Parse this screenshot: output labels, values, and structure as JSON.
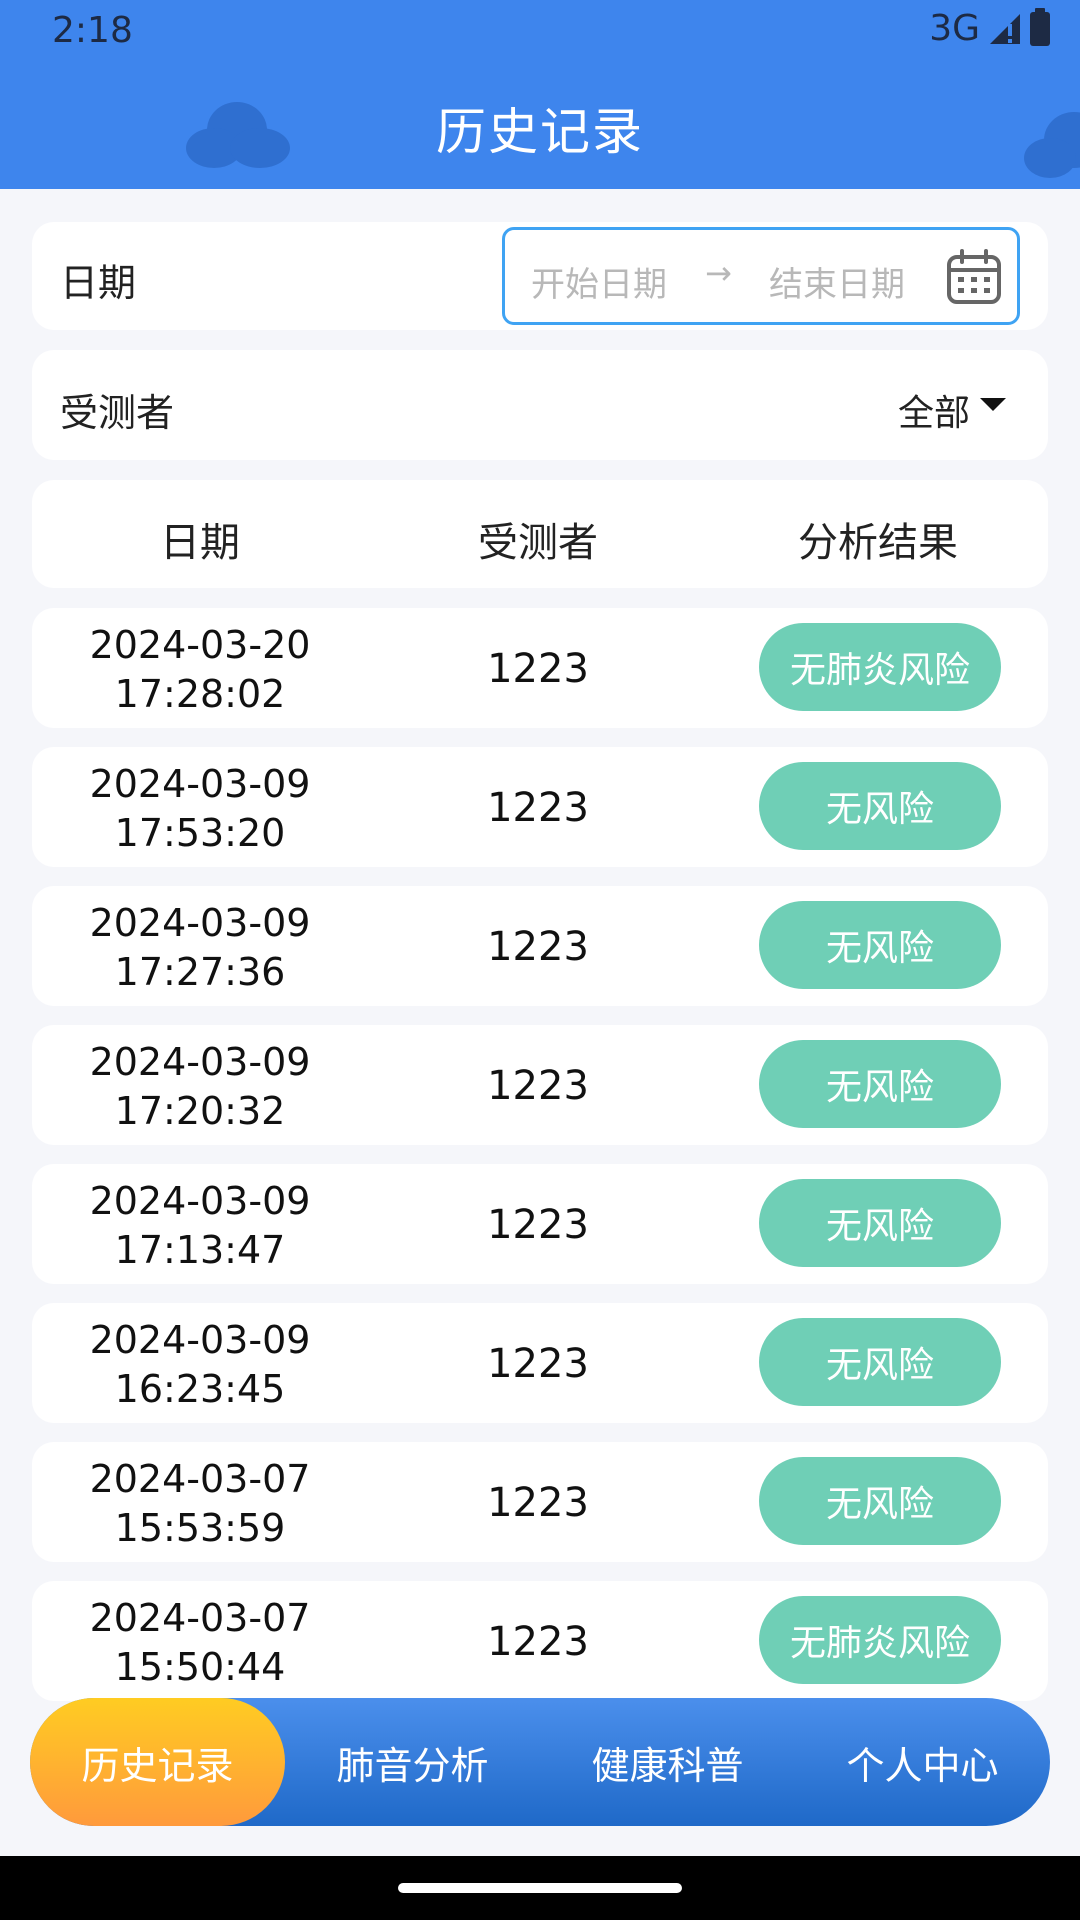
{
  "status_bar": {
    "time": "2:18",
    "network": "3G"
  },
  "header": {
    "title": "历史记录"
  },
  "filter": {
    "date_label": "日期",
    "start_placeholder": "开始日期",
    "range_arrow": "→",
    "end_placeholder": "结束日期",
    "subject_label": "受测者",
    "subject_value": "全部"
  },
  "table": {
    "columns": [
      "日期",
      "受测者",
      "分析结果"
    ],
    "rows": [
      {
        "date": "2024-03-20",
        "time": "17:28:02",
        "subject": "1223",
        "result": "无肺炎风险"
      },
      {
        "date": "2024-03-09",
        "time": "17:53:20",
        "subject": "1223",
        "result": "无风险"
      },
      {
        "date": "2024-03-09",
        "time": "17:27:36",
        "subject": "1223",
        "result": "无风险"
      },
      {
        "date": "2024-03-09",
        "time": "17:20:32",
        "subject": "1223",
        "result": "无风险"
      },
      {
        "date": "2024-03-09",
        "time": "17:13:47",
        "subject": "1223",
        "result": "无风险"
      },
      {
        "date": "2024-03-09",
        "time": "16:23:45",
        "subject": "1223",
        "result": "无风险"
      },
      {
        "date": "2024-03-07",
        "time": "15:53:59",
        "subject": "1223",
        "result": "无风险"
      },
      {
        "date": "2024-03-07",
        "time": "15:50:44",
        "subject": "1223",
        "result": "无肺炎风险"
      }
    ]
  },
  "nav": {
    "items": [
      "历史记录",
      "肺音分析",
      "健康科普",
      "个人中心"
    ],
    "active_index": 0
  },
  "colors": {
    "header_bg": "#3e85ed",
    "badge_bg": "#6fcfb6",
    "nav_bg": "#1f69c8",
    "nav_active": "#ff9a3c",
    "range_border": "#3fa3f3"
  }
}
